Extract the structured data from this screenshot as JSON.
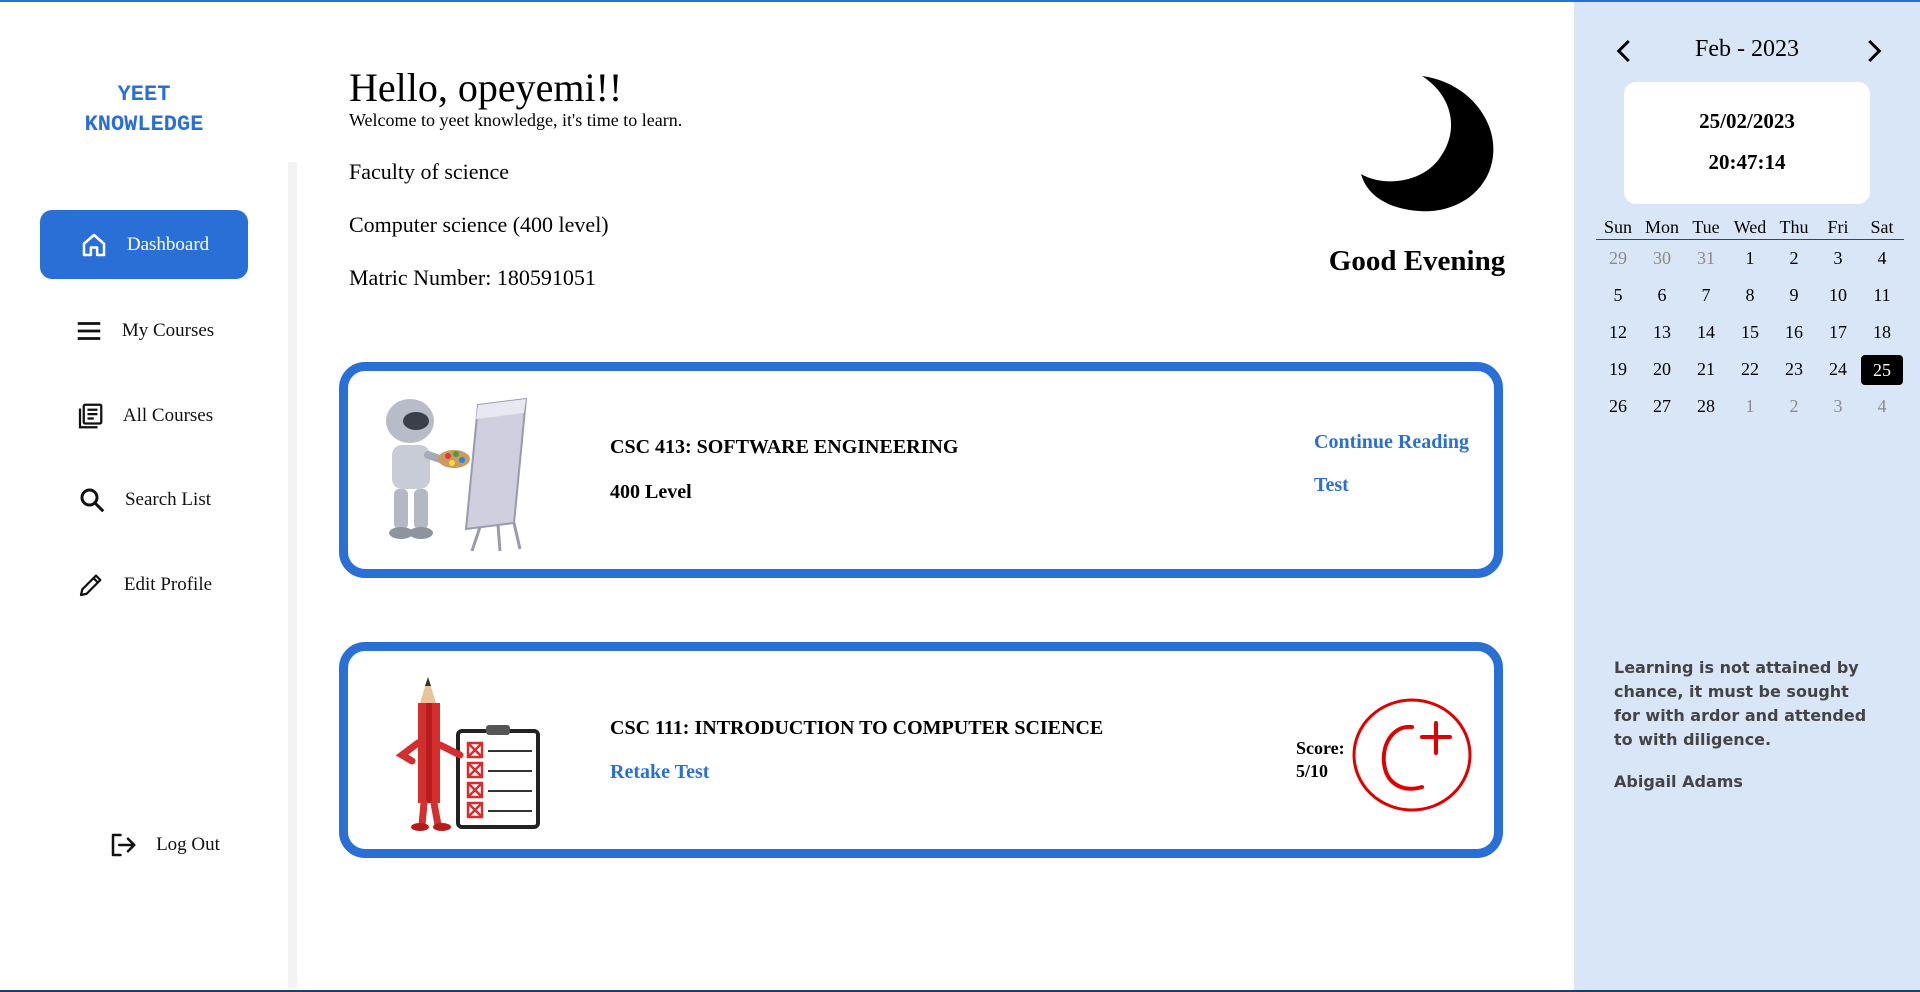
{
  "app": {
    "logo_line1": "YEET",
    "logo_line2": "KNOWLEDGE",
    "accent_color": "#2a6fd6",
    "panel_color": "#d9e6f8"
  },
  "sidebar": {
    "items": [
      {
        "label": "Dashboard",
        "icon": "home-icon",
        "active": true
      },
      {
        "label": "My Courses",
        "icon": "menu-icon"
      },
      {
        "label": "All Courses",
        "icon": "library-icon"
      },
      {
        "label": "Search List",
        "icon": "search-icon"
      },
      {
        "label": "Edit Profile",
        "icon": "pencil-icon"
      }
    ],
    "logout_label": "Log Out"
  },
  "header": {
    "greeting": "Hello, opeyemi!!",
    "welcome": "Welcome to yeet knowledge, it's time to learn.",
    "faculty": "Faculty of science",
    "department": "Computer science (400 level)",
    "matric": "Matric Number: 180591051",
    "time_greeting": "Good Evening",
    "time_icon": "moon-icon"
  },
  "courses": [
    {
      "title": "CSC 413: SOFTWARE ENGINEERING",
      "level": "400 Level",
      "illustration": "robot-painter-illustration",
      "links": [
        "Continue Reading",
        "Test"
      ]
    },
    {
      "title": "CSC 111: INTRODUCTION TO COMPUTER SCIENCE",
      "action": "Retake Test",
      "illustration": "pencil-checklist-illustration",
      "score_label": "Score:",
      "score_value": "5/10",
      "grade": "C+"
    }
  ],
  "calendar": {
    "month_label": "Feb - 2023",
    "date": "25/02/2023",
    "time": "20:47:14",
    "weekdays": [
      "Sun",
      "Mon",
      "Tue",
      "Wed",
      "Thu",
      "Fri",
      "Sat"
    ],
    "weeks": [
      [
        "29",
        "30",
        "31",
        "1",
        "2",
        "3",
        "4"
      ],
      [
        "5",
        "6",
        "7",
        "8",
        "9",
        "10",
        "11"
      ],
      [
        "12",
        "13",
        "14",
        "15",
        "16",
        "17",
        "18"
      ],
      [
        "19",
        "20",
        "21",
        "22",
        "23",
        "24",
        "25"
      ],
      [
        "26",
        "27",
        "28",
        "1",
        "2",
        "3",
        "4"
      ]
    ],
    "selected": "25"
  },
  "quote": {
    "text": "Learning is not attained by chance, it must be sought for with ardor and attended to with diligence.",
    "author": "Abigail Adams"
  }
}
